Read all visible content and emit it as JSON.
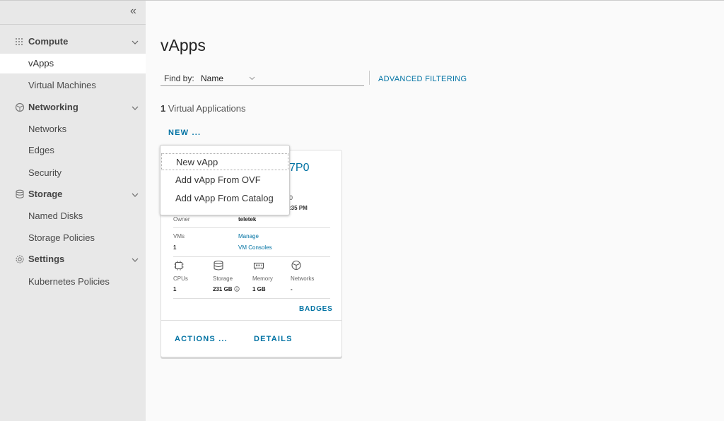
{
  "sidebar": {
    "collapse_glyph": "«",
    "groups": [
      {
        "label": "Compute",
        "icon": "grid-icon"
      },
      {
        "label": "Networking",
        "icon": "network-icon"
      },
      {
        "label": "Storage",
        "icon": "storage-icon"
      },
      {
        "label": "Settings",
        "icon": "gear-icon"
      }
    ],
    "items": {
      "vapps": "vApps",
      "virtual_machines": "Virtual Machines",
      "networks": "Networks",
      "edges": "Edges",
      "security": "Security",
      "named_disks": "Named Disks",
      "storage_policies": "Storage Policies",
      "kubernetes_policies": "Kubernetes Policies"
    },
    "active_item": "vApps"
  },
  "main": {
    "title": "vApps",
    "find_by_label": "Find by:",
    "find_by_value": "Name",
    "advanced_filtering": "ADVANCED FILTERING",
    "count_number": "1",
    "count_text": "Virtual Applications",
    "new_button": "NEW ..."
  },
  "dropdown": {
    "items": [
      "New vApp",
      "Add vApp From OVF",
      "Add vApp From Catalog"
    ]
  },
  "card": {
    "title_fragment": "7P0",
    "date_fragment_top": "0",
    "date_fragment_bottom": ":35 PM",
    "owner_label": "Owner",
    "owner_value": "teletek",
    "vms_label": "VMs",
    "vms_value": "1",
    "manage_link": "Manage",
    "vm_consoles_link": "VM Consoles",
    "resources": {
      "cpus_label": "CPUs",
      "cpus_value": "1",
      "storage_label": "Storage",
      "storage_value": "231 GB",
      "memory_label": "Memory",
      "memory_value": "1 GB",
      "networks_label": "Networks",
      "networks_value": "-"
    },
    "badges_link": "BADGES",
    "actions_button": "ACTIONS ...",
    "details_button": "DETAILS"
  },
  "colors": {
    "accent": "#0072a3",
    "sidebar_bg": "#e8e8e8",
    "page_bg": "#fafafa"
  }
}
